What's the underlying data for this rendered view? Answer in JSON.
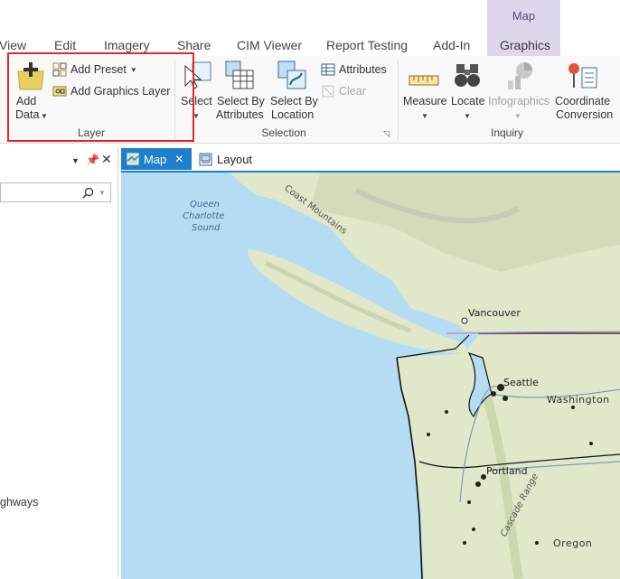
{
  "ribbon_tabs": {
    "context_title": "Map",
    "tabs": [
      "View",
      "Edit",
      "Imagery",
      "Share",
      "CIM Viewer",
      "Report Testing",
      "Add-In",
      "Graphics"
    ]
  },
  "layer_group": {
    "label": "Layer",
    "add_data_line1": "Add",
    "add_data_line2": "Data",
    "add_preset": "Add Preset",
    "add_graphics_layer": "Add Graphics Layer"
  },
  "selection_group": {
    "label": "Selection",
    "select": "Select",
    "select_by_attributes_l1": "Select By",
    "select_by_attributes_l2": "Attributes",
    "select_by_location_l1": "Select By",
    "select_by_location_l2": "Location",
    "attributes": "Attributes",
    "clear": "Clear"
  },
  "inquiry_group": {
    "label": "Inquiry",
    "measure": "Measure",
    "locate": "Locate",
    "infographics": "Infographics",
    "coord_l1": "Coordinate",
    "coord_l2": "Conversion"
  },
  "left_pane": {
    "list_text": "ghways"
  },
  "view_tabs": {
    "map": "Map",
    "layout": "Layout"
  },
  "map_labels": {
    "coast_mountains": "Coast Mountains",
    "queen_l1": "Queen",
    "queen_l2": "Charlotte",
    "queen_l3": "Sound",
    "vancouver": "Vancouver",
    "seattle": "Seattle",
    "washington": "Washington",
    "portland": "Portland",
    "cascade": "Cascade Range",
    "oregon": "Oregon"
  },
  "colors": {
    "accent": "#1e7fcb",
    "highlight": "#e0262f",
    "water": "#b5dcf2",
    "land": "#dfe8c8"
  }
}
